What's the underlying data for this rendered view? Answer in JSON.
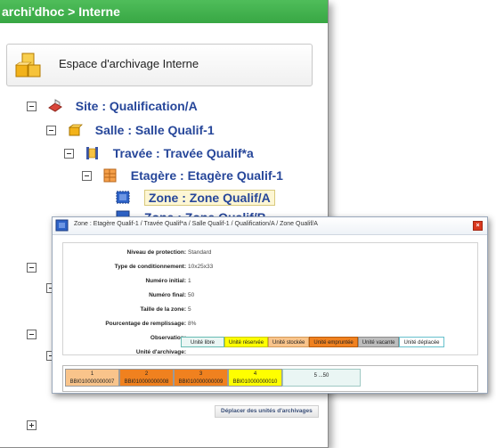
{
  "panel": {
    "header_title": "archi'dhoc > Interne",
    "space_label": "Espace d'archivage Interne"
  },
  "tree": {
    "site": "Site : Qualification/A",
    "salle": "Salle : Salle Qualif-1",
    "travee": "Travée : Travée Qualif*a",
    "etagere": "Etagère : Etagère Qualif-1",
    "zone_selected": "Zone : Zone Qualif/A",
    "zone_next": "Zone : Zone Qualif/B"
  },
  "dialog": {
    "title": "Zone : Etagère Qualif-1 / Travée Qualif*a / Salle Qualif-1 / Qualification/A / Zone Qualif/A",
    "close_label": "×",
    "details": [
      {
        "key": "Niveau de protection:",
        "value": "Standard"
      },
      {
        "key": "Type de conditionnement:",
        "value": "10x25x33"
      },
      {
        "key": "Numéro initial:",
        "value": "1"
      },
      {
        "key": "Numéro final:",
        "value": "50"
      },
      {
        "key": "Taille de la zone:",
        "value": "5"
      },
      {
        "key": "Pourcentage de remplissage:",
        "value": "8%"
      },
      {
        "key": "Observation:",
        "value": ""
      },
      {
        "key": "Unité d'archivage:",
        "value": ""
      }
    ],
    "legend": [
      {
        "label": "Unité libre",
        "color": "#eaf6f4",
        "border": "#66bbb3"
      },
      {
        "label": "Unité réservée",
        "color": "#ffff00",
        "border": "#c9c900"
      },
      {
        "label": "Unité stockée",
        "color": "#f9c48b",
        "border": "#d49a5a"
      },
      {
        "label": "Unité empruntée",
        "color": "#f0811f",
        "border": "#b85c0c"
      },
      {
        "label": "Unité vacante",
        "color": "#bdbdbd",
        "border": "#8d8d8d"
      },
      {
        "label": "Unité déplacée",
        "color": "#ffffff",
        "border": "#66c0cc"
      }
    ],
    "units": [
      {
        "num": "1",
        "code": "BBI010000000007",
        "color": "#f9c48b"
      },
      {
        "num": "2",
        "code": "BBI010000000008",
        "color": "#f0811f"
      },
      {
        "num": "3",
        "code": "BBI010000000009",
        "color": "#f0811f"
      },
      {
        "num": "4",
        "code": "BBI010000000010",
        "color": "#ffff00"
      },
      {
        "num": "5 ...50",
        "code": "",
        "color": "#eaf6f4"
      }
    ],
    "move_button_label": "Déplacer des unités d'archivages"
  }
}
